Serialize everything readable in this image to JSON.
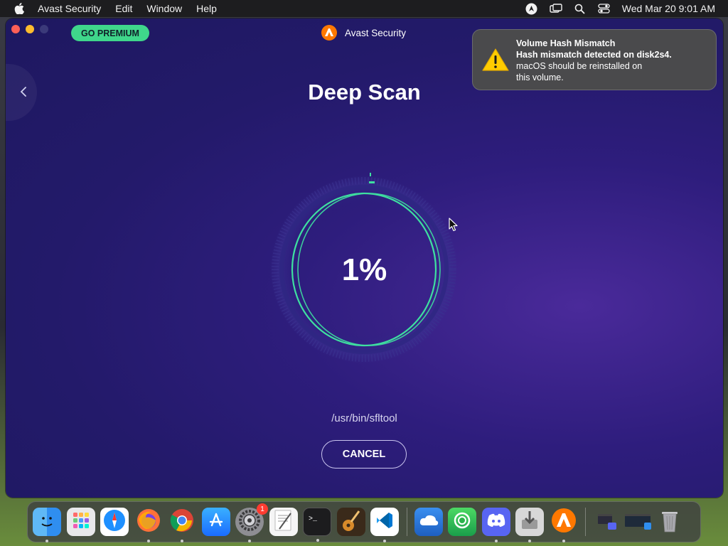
{
  "menubar": {
    "app_name": "Avast Security",
    "items": [
      "Edit",
      "Window",
      "Help"
    ],
    "clock": "Wed Mar 20  9:01 AM"
  },
  "window": {
    "premium_label": "GO PREMIUM",
    "app_title": "Avast Security",
    "scan_title": "Deep Scan",
    "progress": {
      "value": 0.01,
      "label": "1%"
    },
    "scan_path": "/usr/bin/sfltool",
    "cancel_label": "CANCEL"
  },
  "notification": {
    "title": "Volume Hash Mismatch",
    "line1": "Hash mismatch detected on disk2s4.",
    "line2": "macOS should be reinstalled on",
    "line3": "this volume."
  },
  "dock": {
    "apps": [
      {
        "name": "finder-icon",
        "color": "#2f8ef0"
      },
      {
        "name": "launchpad-icon",
        "color": "#e6e6e6"
      },
      {
        "name": "safari-icon",
        "color": "#1e90ff"
      },
      {
        "name": "firefox-icon",
        "color": "#ff7139"
      },
      {
        "name": "chrome-icon",
        "color": "#ffffff"
      },
      {
        "name": "app-store-icon",
        "color": "#1a8cff"
      },
      {
        "name": "system-settings-icon",
        "color": "#8e8e93",
        "badge": "1"
      },
      {
        "name": "textedit-icon",
        "color": "#f5f5f5"
      },
      {
        "name": "terminal-icon",
        "color": "#1c1c1e"
      },
      {
        "name": "garageband-icon",
        "color": "#3a2a1a"
      },
      {
        "name": "vscode-icon",
        "color": "#ffffff"
      },
      {
        "name": "weather-icon",
        "color": "#2a7de1"
      },
      {
        "name": "find-my-icon",
        "color": "#2bb24c"
      },
      {
        "name": "discord-icon",
        "color": "#5865f2"
      },
      {
        "name": "installer-icon",
        "color": "#d8d8d8"
      },
      {
        "name": "avast-icon",
        "color": "#ff7800"
      }
    ]
  },
  "colors": {
    "accent_green": "#3fd68b",
    "window_bg": "#231a6a",
    "ring": "#3ee0a0"
  }
}
